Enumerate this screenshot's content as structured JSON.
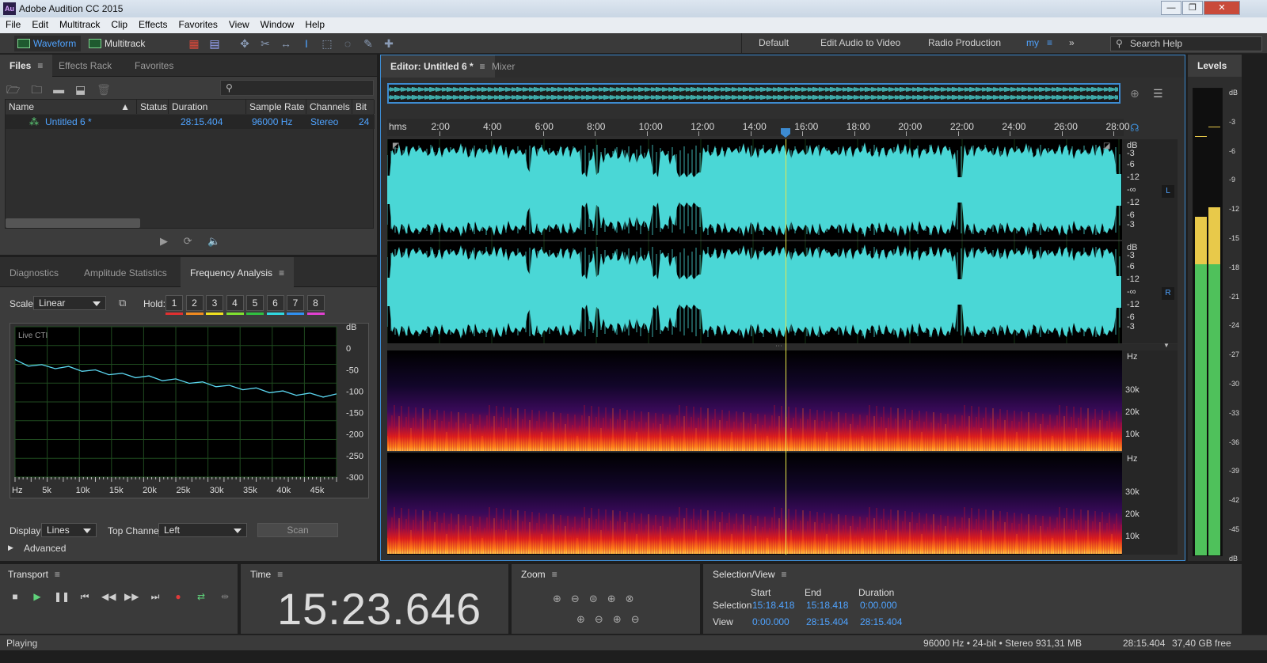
{
  "app": {
    "title": "Adobe Audition CC 2015",
    "logo": "Au",
    "window_controls": [
      "—",
      "❐",
      "✕"
    ]
  },
  "menu": [
    "File",
    "Edit",
    "Multitrack",
    "Clip",
    "Effects",
    "Favorites",
    "View",
    "Window",
    "Help"
  ],
  "toolbar": {
    "waveform_label": "Waveform",
    "multitrack_label": "Multitrack",
    "workspaces": [
      "Default",
      "Edit Audio to Video",
      "Radio Production",
      "my"
    ],
    "search_placeholder": "Search Help"
  },
  "files_panel": {
    "tabs": [
      "Files",
      "Effects Rack",
      "Favorites"
    ],
    "columns": [
      "Name",
      "Status",
      "Duration",
      "Sample Rate",
      "Channels",
      "Bit D"
    ],
    "rows": [
      {
        "name": "Untitled 6 *",
        "status": "",
        "duration": "28:15.404",
        "sample_rate": "96000 Hz",
        "channels": "Stereo",
        "bit_depth": "24"
      }
    ]
  },
  "analysis_panel": {
    "tabs": [
      "Diagnostics",
      "Amplitude Statistics",
      "Frequency Analysis"
    ],
    "scale_label": "Scale:",
    "scale_value": "Linear",
    "hold_label": "Hold:",
    "hold_buttons": [
      "1",
      "2",
      "3",
      "4",
      "5",
      "6",
      "7",
      "8"
    ],
    "hold_colors": [
      "#e03030",
      "#f08a20",
      "#f0e020",
      "#80e030",
      "#30c040",
      "#30d8e0",
      "#3090f0",
      "#e040d0"
    ],
    "display_label": "Display:",
    "display_value": "Lines",
    "top_channel_label": "Top Channel:",
    "top_channel_value": "Left",
    "scan_label": "Scan",
    "advanced_label": "Advanced"
  },
  "chart_data": {
    "type": "line",
    "title": "Live CTI",
    "xlabel": "Hz",
    "ylabel": "dB",
    "x_ticks": [
      "Hz",
      "5k",
      "10k",
      "15k",
      "20k",
      "25k",
      "30k",
      "35k",
      "40k",
      "45k"
    ],
    "y_ticks": [
      "dB",
      "0",
      "-50",
      "-100",
      "-150",
      "-200",
      "-250",
      "-300"
    ],
    "xlim": [
      0,
      48000
    ],
    "ylim": [
      -300,
      50
    ],
    "series": [
      {
        "color": "#5bd6f0",
        "x": [
          0,
          2000,
          4000,
          6000,
          8000,
          10000,
          12000,
          14000,
          16000,
          18000,
          20000,
          22000,
          24000,
          26000,
          28000,
          30000,
          32000,
          34000,
          36000,
          38000,
          40000,
          42000,
          44000,
          46000,
          48000
        ],
        "y": [
          -30,
          -38,
          -42,
          -44,
          -46,
          -50,
          -54,
          -58,
          -62,
          -65,
          -68,
          -72,
          -75,
          -78,
          -82,
          -86,
          -90,
          -93,
          -96,
          -100,
          -103,
          -106,
          -108,
          -110,
          -110
        ]
      }
    ]
  },
  "editor": {
    "tabs": [
      "Editor: Untitled 6 *",
      "Mixer"
    ],
    "time_ruler": [
      "hms",
      "2:00",
      "4:00",
      "6:00",
      "8:00",
      "10:00",
      "12:00",
      "14:00",
      "16:00",
      "18:00",
      "20:00",
      "22:00",
      "24:00",
      "26:00",
      "28:00"
    ],
    "db_scale": [
      "dB",
      "-3",
      "-6",
      "-12",
      "-∞",
      "-12",
      "-6",
      "-3"
    ],
    "channel_labels": [
      "L",
      "R"
    ],
    "freq_scale": [
      "Hz",
      "30k",
      "20k",
      "10k"
    ],
    "playhead_position": "15:23.646",
    "total_duration": "28:15.404"
  },
  "levels": {
    "title": "Levels",
    "scale": [
      "dB",
      "-3",
      "-6",
      "-9",
      "-12",
      "-15",
      "-18",
      "-21",
      "-24",
      "-27",
      "-30",
      "-33",
      "-36",
      "-39",
      "-42",
      "-45",
      "dB"
    ]
  },
  "transport": {
    "title": "Transport",
    "buttons": [
      "stop",
      "play",
      "pause",
      "go-to-start",
      "rewind",
      "fast-forward",
      "go-to-end",
      "record",
      "loop",
      "skip"
    ]
  },
  "time": {
    "title": "Time",
    "value": "15:23.646"
  },
  "zoom": {
    "title": "Zoom"
  },
  "selection_view": {
    "title": "Selection/View",
    "headers": [
      "Start",
      "End",
      "Duration"
    ],
    "rows": [
      {
        "label": "Selection",
        "start": "15:18.418",
        "end": "15:18.418",
        "duration": "0:00.000"
      },
      {
        "label": "View",
        "start": "0:00.000",
        "end": "28:15.404",
        "duration": "28:15.404"
      }
    ]
  },
  "status": {
    "state": "Playing",
    "format": "96000 Hz • 24-bit • Stereo",
    "size": "931,31 MB",
    "duration": "28:15.404",
    "free": "37,40 GB free"
  }
}
